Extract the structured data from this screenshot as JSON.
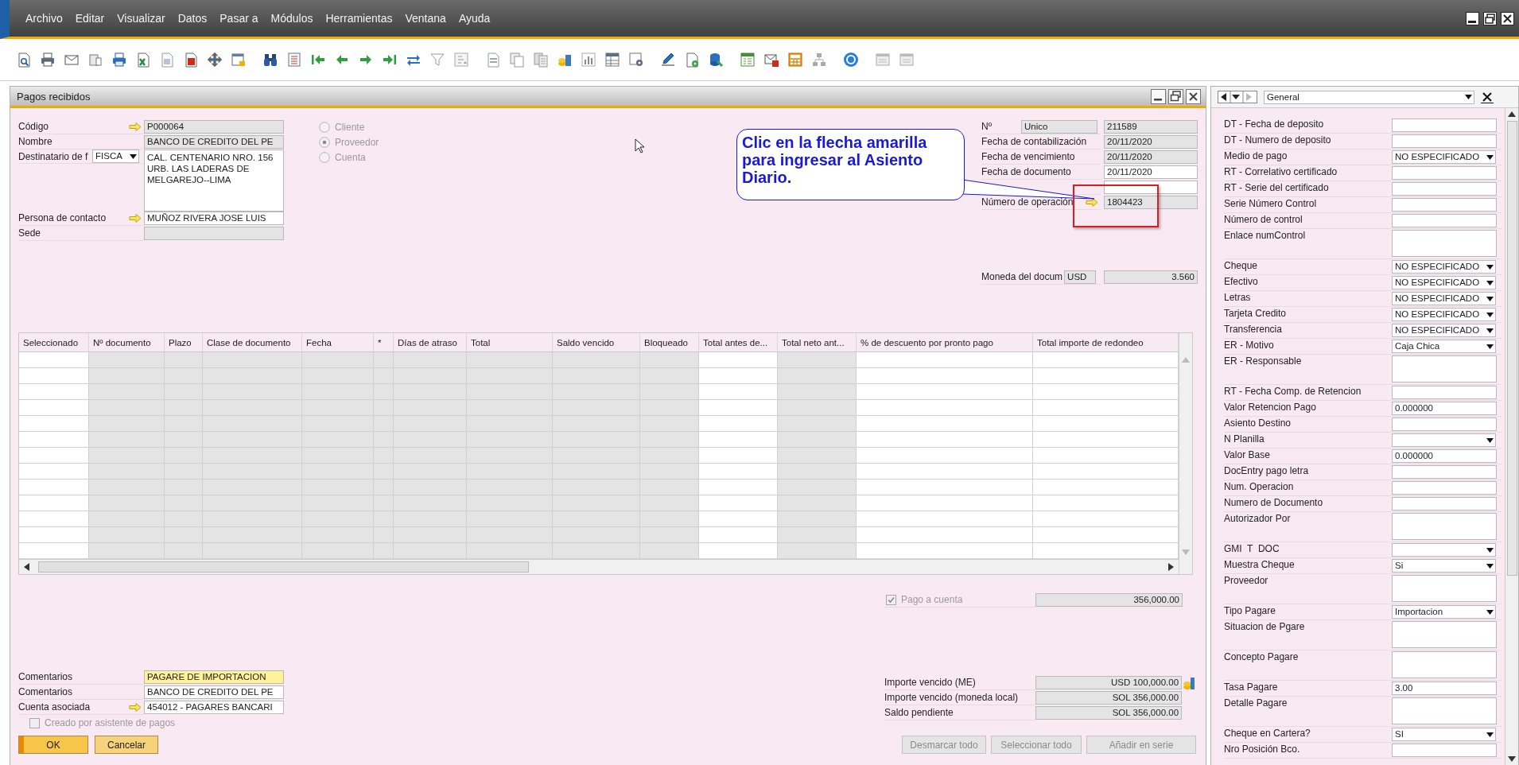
{
  "menu": [
    {
      "label": "Archivo"
    },
    {
      "label": "Editar"
    },
    {
      "label": "Visualizar"
    },
    {
      "label": "Datos"
    },
    {
      "label": "Pasar a"
    },
    {
      "label": "Módulos"
    },
    {
      "label": "Herramientas"
    },
    {
      "label": "Ventana"
    },
    {
      "label": "Ayuda"
    }
  ],
  "window": {
    "title": "Pagos recibidos"
  },
  "partner_fields": [
    {
      "label": "Código",
      "link": true,
      "value": "P000064",
      "readonly": true,
      "kind": "text"
    },
    {
      "label": "Nombre",
      "link": false,
      "value": "BANCO DE CREDITO DEL PE",
      "readonly": true,
      "kind": "text"
    },
    {
      "label": "Destinatario de f",
      "link": false,
      "option": "FISCA",
      "value": "CAL. CENTENARIO NRO. 156\nURB. LAS LADERAS DE\nMELGAREJO--LIMA",
      "readonly": false,
      "kind": "address"
    },
    {
      "label": "Persona de contacto",
      "link": true,
      "value": "MUÑOZ RIVERA JOSE LUIS",
      "readonly": false,
      "kind": "text"
    },
    {
      "label": "Sede",
      "link": false,
      "readonly": true,
      "kind": "text"
    }
  ],
  "partner_type": [
    {
      "label": "Cliente",
      "selected": false,
      "disabled": true
    },
    {
      "label": "Proveedor",
      "selected": true,
      "disabled": true
    },
    {
      "label": "Cuenta",
      "selected": false,
      "disabled": true
    }
  ],
  "document_fields": [
    {
      "label": "Nº",
      "series": "Unico",
      "value": "211589",
      "readonly": true,
      "link": false
    },
    {
      "label": "Fecha de contabilización",
      "value": "20/11/2020",
      "readonly": true,
      "link": false
    },
    {
      "label": "Fecha de vencimiento",
      "value": "20/11/2020",
      "readonly": true,
      "link": false
    },
    {
      "label": "Fecha de documento",
      "value": "20/11/2020",
      "readonly": false,
      "link": false
    },
    {
      "readonly": false,
      "link": false
    },
    {
      "label": "Número de operación",
      "value": "1804423",
      "readonly": true,
      "link": true
    }
  ],
  "currency": {
    "label": "Moneda del docum",
    "code": "USD",
    "rate": "3.560"
  },
  "callout": {
    "text": "Clic en la flecha amarilla para ingresar al Asiento Diario."
  },
  "table": {
    "columns": [
      {
        "label": "Seleccionado",
        "editable": true
      },
      {
        "label": "Nº documento",
        "editable": false
      },
      {
        "label": "Plazo",
        "editable": false
      },
      {
        "label": "Clase de documento",
        "editable": false
      },
      {
        "label": "Fecha",
        "editable": false
      },
      {
        "label": "*",
        "editable": false
      },
      {
        "label": "Días de atraso",
        "editable": false
      },
      {
        "label": "Total",
        "editable": false
      },
      {
        "label": "Saldo vencido",
        "editable": false
      },
      {
        "label": "Bloqueado",
        "editable": false
      },
      {
        "label": "Total antes de...",
        "editable": true
      },
      {
        "label": "Total neto ant...",
        "editable": false
      },
      {
        "label": "% de descuento por pronto pago",
        "editable": true
      },
      {
        "label": "Total importe de redondeo",
        "editable": true
      }
    ]
  },
  "on_account": {
    "label": "Pago a cuenta",
    "checked": true,
    "disabled": true,
    "value": "356,000.00"
  },
  "totals": [
    {
      "label": "Importe vencido (ME)",
      "value": "USD 100,000.00",
      "kind": "drilldown"
    },
    {
      "label": "Importe vencido (moneda local)",
      "value": "SOL 356,000.00",
      "kind": "amount"
    },
    {
      "label": "Saldo pendiente",
      "value": "SOL 356,000.00",
      "kind": "amount"
    }
  ],
  "remarks": [
    {
      "label": "Comentarios",
      "value": "PAGARE DE IMPORTACION",
      "highlighted": true,
      "link": false
    },
    {
      "label": "Comentarios",
      "value": "BANCO DE CREDITO DEL PE",
      "highlighted": false,
      "link": false
    },
    {
      "label": "Cuenta asociada",
      "value": "454012 - PAGARES BANCARI",
      "highlighted": false,
      "link": true
    }
  ],
  "wizard": {
    "label": "Creado por asistente de pagos",
    "checked": false,
    "disabled": true
  },
  "buttons": [
    {
      "label": "OK",
      "kind": "primary"
    },
    {
      "label": "Cancelar",
      "kind": "secondary"
    }
  ],
  "table_buttons": [
    {
      "label": "Desmarcar todo",
      "disabled": true
    },
    {
      "label": "Seleccionar todo",
      "disabled": true
    },
    {
      "label": "Añadir en serie",
      "disabled": true
    }
  ],
  "side_panel": {
    "view": "General",
    "fields": [
      {
        "label": "DT - Fecha de deposito",
        "kind": "text"
      },
      {
        "label": "DT - Numero de deposito",
        "kind": "text"
      },
      {
        "label": "Medio de pago",
        "kind": "select",
        "value": "NO ESPECIFICADO"
      },
      {
        "label": "RT - Correlativo certificado",
        "kind": "text"
      },
      {
        "label": "RT - Serie del certificado",
        "kind": "text"
      },
      {
        "label": "Serie Número Control",
        "kind": "text"
      },
      {
        "label": "Número de control",
        "kind": "text"
      },
      {
        "label": "Enlace numControl",
        "kind": "memo"
      },
      {
        "label": "Cheque",
        "kind": "select",
        "value": "NO ESPECIFICADO"
      },
      {
        "label": "Efectivo",
        "kind": "select",
        "value": "NO ESPECIFICADO"
      },
      {
        "label": "Letras",
        "kind": "select",
        "value": "NO ESPECIFICADO"
      },
      {
        "label": "Tarjeta Credito",
        "kind": "select",
        "value": "NO ESPECIFICADO"
      },
      {
        "label": "Transferencia",
        "kind": "select",
        "value": "NO ESPECIFICADO"
      },
      {
        "label": "ER - Motivo",
        "kind": "select",
        "value": "Caja Chica"
      },
      {
        "label": "ER - Responsable",
        "kind": "memo"
      },
      {
        "label": "RT - Fecha Comp. de Retencion",
        "kind": "text"
      },
      {
        "label": "Valor Retencion Pago",
        "kind": "text",
        "value": "0.000000"
      },
      {
        "label": "Asiento Destino",
        "kind": "text"
      },
      {
        "label": "N Planilla",
        "kind": "select"
      },
      {
        "label": "Valor Base",
        "kind": "text",
        "value": "0.000000"
      },
      {
        "label": "DocEntry pago letra",
        "kind": "text"
      },
      {
        "label": "Num. Operacion",
        "kind": "text"
      },
      {
        "label": "Numero de Documento",
        "kind": "text"
      },
      {
        "label": "Autorizador Por",
        "kind": "memo"
      },
      {
        "label": "GMI  T  DOC",
        "kind": "select"
      },
      {
        "label": "Muestra Cheque",
        "kind": "select",
        "value": "Si"
      },
      {
        "label": "Proveedor",
        "kind": "memo"
      },
      {
        "label": "Tipo Pagare",
        "kind": "select",
        "value": "Importacion"
      },
      {
        "label": "Situacion de Pgare",
        "kind": "memo"
      },
      {
        "label": "Concepto Pagare",
        "kind": "memo"
      },
      {
        "label": "Tasa Pagare",
        "kind": "text",
        "value": "3.00"
      },
      {
        "label": "Detalle Pagare",
        "kind": "memo"
      },
      {
        "label": "Cheque en Cartera?",
        "kind": "select",
        "value": "SI"
      },
      {
        "label": "Nro Posición Bco.",
        "kind": "text"
      }
    ]
  }
}
